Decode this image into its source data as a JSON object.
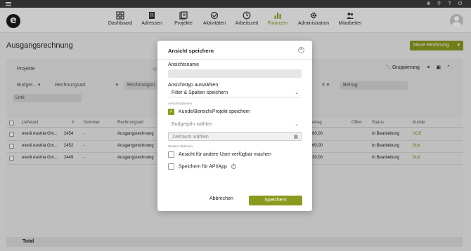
{
  "topbar": {
    "icons": [
      "plus-circle-icon",
      "search-icon",
      "help-icon",
      "power-icon"
    ]
  },
  "nav": {
    "items": [
      {
        "label": "Dashboard",
        "icon": "dashboard-icon"
      },
      {
        "label": "Adressen",
        "icon": "building-icon"
      },
      {
        "label": "Projekte",
        "icon": "projects-icon"
      },
      {
        "label": "Aktivitäten",
        "icon": "activity-icon"
      },
      {
        "label": "Arbeitszeit",
        "icon": "clock-icon"
      },
      {
        "label": "Finanzen",
        "icon": "chart-icon"
      },
      {
        "label": "Administration",
        "icon": "gear-icon"
      },
      {
        "label": "Mitarbeiter",
        "icon": "users-icon"
      }
    ],
    "active": "Finanzen",
    "accent": "#8a9a1e"
  },
  "page": {
    "title": "Ausgangsrechnung",
    "new_button": "Neue Rechnung"
  },
  "filters": {
    "header": "Projekte",
    "group_label": "Gruppierung",
    "budget": "Budget...",
    "rechnungsart": "Rechnungsart",
    "rechnungsnr": "Rechnungsn",
    "betrag": "Betrag",
    "link": "Link"
  },
  "table": {
    "columns": [
      "Lieferant",
      "#",
      "Nummer",
      "Rechnungsart",
      "...etrag",
      "Offen",
      "Status",
      "Kunde"
    ],
    "rows": [
      {
        "lieferant": "everii Austria Gm...",
        "nr": "2454",
        "nummer": "-",
        "art": "Ausgangsrechnung",
        "betrag": "...60,00",
        "status": "In Bearbeitung",
        "kunde": "AGE"
      },
      {
        "lieferant": "everii Austria Gm...",
        "nr": "2452",
        "nummer": "-",
        "art": "Ausgangsrechnung",
        "betrag": "...60,00",
        "status": "In Bearbeitung",
        "kunde": "Butt"
      },
      {
        "lieferant": "everii Austria Gm...",
        "nr": "2449",
        "nummer": "-",
        "art": "Ausgangsrechnung",
        "betrag": "...30,00",
        "status": "In Bearbeitung",
        "kunde": "Butt"
      }
    ],
    "total_label": "Total"
  },
  "modal": {
    "title": "Ansicht speichern",
    "name_label": "Ansichtsname",
    "name_value": "",
    "type_label": "Ansichtstyp auswählen",
    "type_value": "Filter & Spalten speichern",
    "options_label": "Ansichtsoptionen",
    "save_project_label": "Kunde/Bereich/Projekt speichern",
    "save_project_checked": true,
    "budget_year_placeholder": "Budgetjahr wählen",
    "period_placeholder": "Zeitraum wählen",
    "more_options_label": "Weitere Optionen",
    "share_label": "Ansicht für andere User verfügbar machen",
    "api_label": "Speichern für API/App",
    "cancel_label": "Abbrechen",
    "save_label": "Speichern"
  }
}
